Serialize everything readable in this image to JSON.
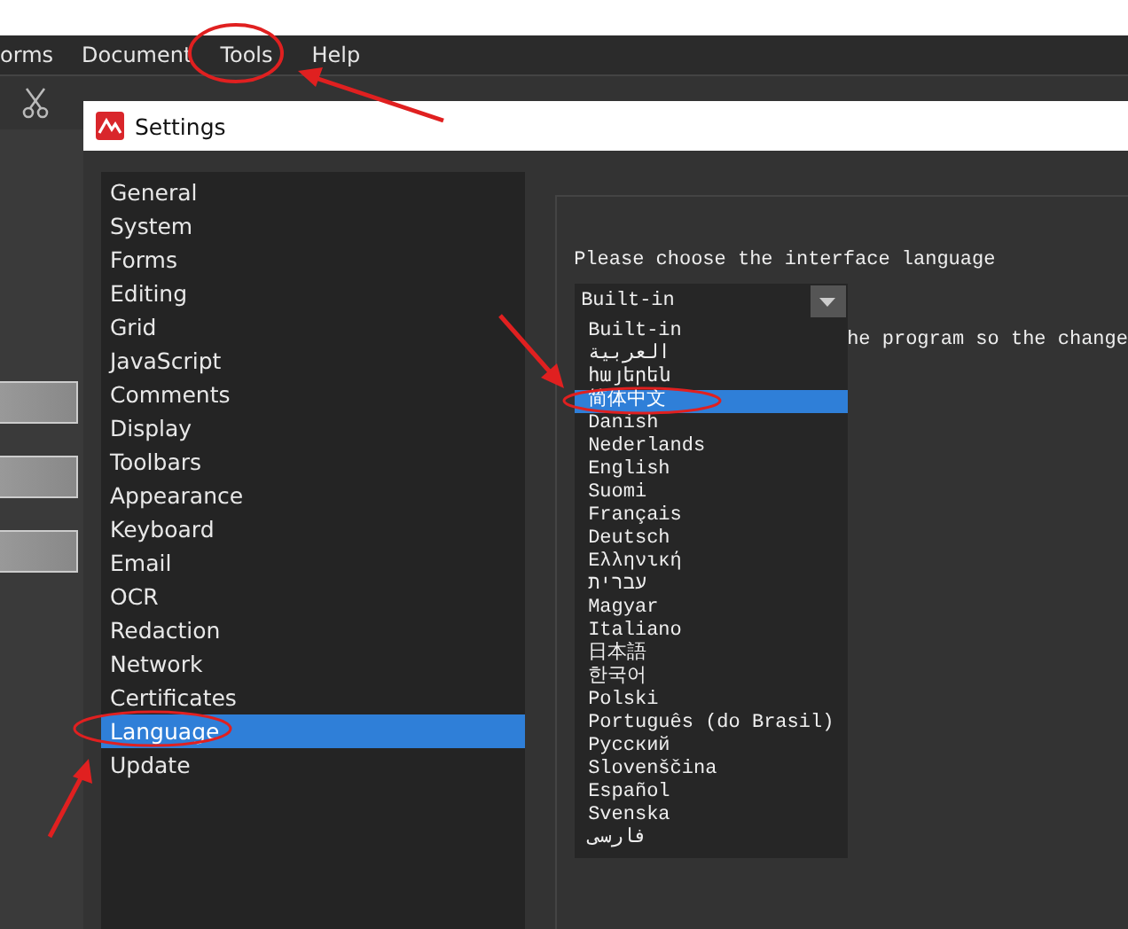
{
  "app_menu": [
    {
      "label": "orms"
    },
    {
      "label": "Document"
    },
    {
      "label": "Tools"
    },
    {
      "label": "Help"
    }
  ],
  "settings": {
    "title": "Settings",
    "categories": [
      {
        "label": "General",
        "selected": false
      },
      {
        "label": "System",
        "selected": false
      },
      {
        "label": "Forms",
        "selected": false
      },
      {
        "label": "Editing",
        "selected": false
      },
      {
        "label": "Grid",
        "selected": false
      },
      {
        "label": "JavaScript",
        "selected": false
      },
      {
        "label": "Comments",
        "selected": false
      },
      {
        "label": "Display",
        "selected": false
      },
      {
        "label": "Toolbars",
        "selected": false
      },
      {
        "label": "Appearance",
        "selected": false
      },
      {
        "label": "Keyboard",
        "selected": false
      },
      {
        "label": "Email",
        "selected": false
      },
      {
        "label": "OCR",
        "selected": false
      },
      {
        "label": "Redaction",
        "selected": false
      },
      {
        "label": "Network",
        "selected": false
      },
      {
        "label": "Certificates",
        "selected": false
      },
      {
        "label": "Language",
        "selected": true
      },
      {
        "label": "Update",
        "selected": false
      }
    ],
    "language": {
      "prompt": "Please choose the interface language",
      "combo_value": "Built-in",
      "note": "he program so the change",
      "options": [
        {
          "label": "Built-in",
          "selected": false
        },
        {
          "label": "العربية",
          "selected": false
        },
        {
          "label": "հայերեն",
          "selected": false
        },
        {
          "label": "简体中文",
          "selected": true
        },
        {
          "label": "Danish",
          "selected": false
        },
        {
          "label": "Nederlands",
          "selected": false
        },
        {
          "label": "English",
          "selected": false
        },
        {
          "label": "Suomi",
          "selected": false
        },
        {
          "label": "Français",
          "selected": false
        },
        {
          "label": "Deutsch",
          "selected": false
        },
        {
          "label": "Ελληνική",
          "selected": false
        },
        {
          "label": "עברית",
          "selected": false
        },
        {
          "label": "Magyar",
          "selected": false
        },
        {
          "label": "Italiano",
          "selected": false
        },
        {
          "label": "日本語",
          "selected": false
        },
        {
          "label": "한국어",
          "selected": false
        },
        {
          "label": "Polski",
          "selected": false
        },
        {
          "label": "Português (do Brasil)",
          "selected": false
        },
        {
          "label": "Русский",
          "selected": false
        },
        {
          "label": "Slovenščina",
          "selected": false
        },
        {
          "label": "Español",
          "selected": false
        },
        {
          "label": "Svenska",
          "selected": false
        },
        {
          "label": "فارسی",
          "selected": false
        }
      ]
    }
  }
}
